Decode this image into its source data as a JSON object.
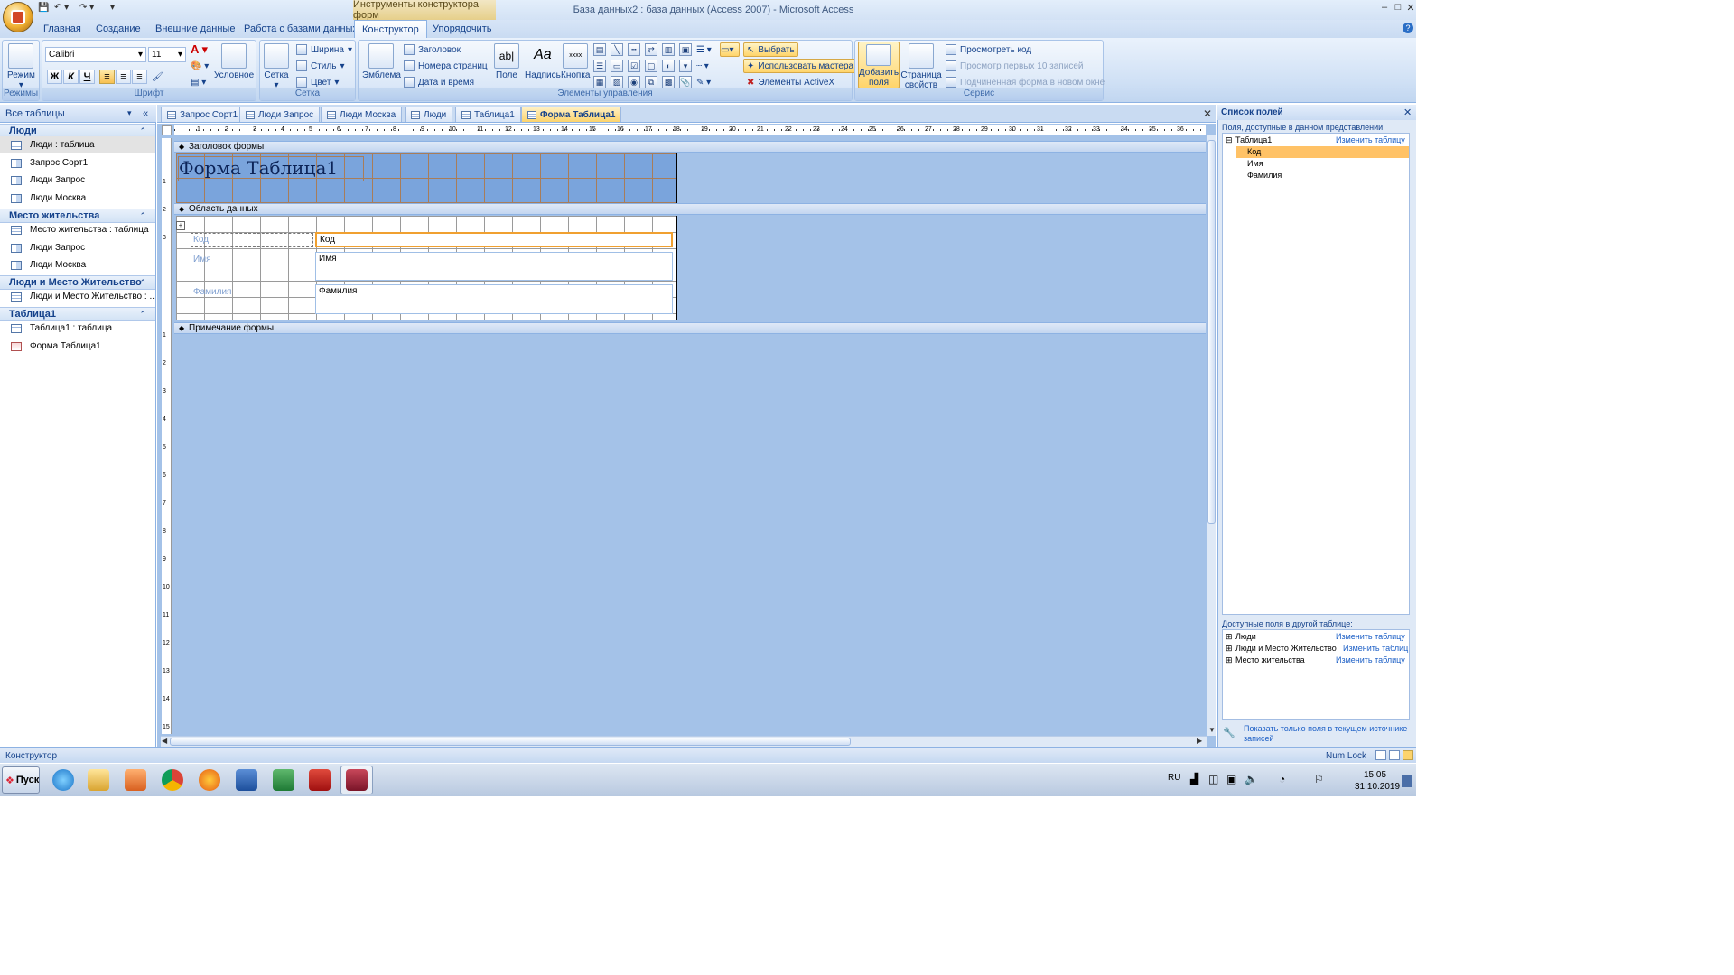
{
  "window": {
    "context_header": "Инструменты конструктора форм",
    "title": "База данных2 : база данных (Access 2007) - Microsoft Access",
    "controls": [
      "–",
      "□",
      "✕"
    ]
  },
  "ribbon_tabs": [
    "Главная",
    "Создание",
    "Внешние данные",
    "Работа с базами данных",
    "Конструктор",
    "Упорядочить"
  ],
  "active_tab": "Конструктор",
  "ribbon": {
    "views": {
      "label": "Режим",
      "group": "Режимы"
    },
    "font": {
      "group": "Шрифт",
      "font_name": "Calibri",
      "font_size": "11",
      "bold": "Ж",
      "italic": "К",
      "underline": "Ч",
      "conditional": "Условное"
    },
    "grid": {
      "group": "Сетка",
      "grid": "Сетка",
      "width": "Ширина",
      "style": "Стиль",
      "color": "Цвет"
    },
    "controls": {
      "group": "Элементы управления",
      "logo": "Эмблема",
      "title": "Заголовок",
      "page_numbers": "Номера страниц",
      "date_time": "Дата и время",
      "field": "Поле",
      "label": "Надпись",
      "button": "Кнопка",
      "select": "Выбрать",
      "use_wizard": "Использовать мастера",
      "activex": "Элементы ActiveX"
    },
    "tools": {
      "group": "Сервис",
      "add_fields": "Добавить поля",
      "property_sheet": "Страница свойств",
      "view_code": "Просмотреть код",
      "first10": "Просмотр первых 10 записей",
      "subform_new_window": "Подчиненная форма в новом окне"
    }
  },
  "nav": {
    "header": "Все таблицы",
    "groups": [
      {
        "name": "Люди",
        "items": [
          {
            "label": "Люди : таблица",
            "kind": "table",
            "selected": true
          },
          {
            "label": "Запрос Сорт1",
            "kind": "query"
          },
          {
            "label": "Люди Запрос",
            "kind": "query"
          },
          {
            "label": "Люди Москва",
            "kind": "query"
          }
        ]
      },
      {
        "name": "Место жительства",
        "items": [
          {
            "label": "Место жительства : таблица",
            "kind": "table"
          },
          {
            "label": "Люди Запрос",
            "kind": "query"
          },
          {
            "label": "Люди Москва",
            "kind": "query"
          }
        ]
      },
      {
        "name": "Люди и Место Жительство",
        "items": [
          {
            "label": "Люди и Место Жительство : ...",
            "kind": "table"
          }
        ]
      },
      {
        "name": "Таблица1",
        "items": [
          {
            "label": "Таблица1 : таблица",
            "kind": "table"
          },
          {
            "label": "Форма Таблица1",
            "kind": "form"
          }
        ]
      }
    ]
  },
  "doc_tabs": [
    "Запрос Сорт1",
    "Люди Запрос",
    "Люди Москва",
    "Люди",
    "Таблица1",
    "Форма Таблица1"
  ],
  "active_doc_tab": "Форма Таблица1",
  "design": {
    "sections": {
      "header": "Заголовок формы",
      "detail": "Область данных",
      "footer": "Примечание формы"
    },
    "form_title": "Форма Таблица1",
    "fields": [
      {
        "label": "Код",
        "value": "Код"
      },
      {
        "label": "Имя",
        "value": "Имя"
      },
      {
        "label": "Фамилия",
        "value": "Фамилия"
      }
    ],
    "ruler_marks": [
      "1",
      "2",
      "3",
      "4",
      "5",
      "6",
      "7",
      "8",
      "9",
      "10",
      "11",
      "12",
      "13",
      "14",
      "15",
      "16",
      "17",
      "18",
      "19",
      "20",
      "21",
      "22",
      "23",
      "24",
      "25",
      "26",
      "27",
      "28",
      "29",
      "30",
      "31",
      "32",
      "33",
      "34",
      "35",
      "36"
    ]
  },
  "field_list": {
    "title": "Список полей",
    "available_here": "Поля, доступные в данном представлении:",
    "table": "Таблица1",
    "edit_table": "Изменить таблицу",
    "fields": [
      "Код",
      "Имя",
      "Фамилия"
    ],
    "selected_field": "Код",
    "other_label": "Доступные поля в другой таблице:",
    "other_tables": [
      {
        "name": "Люди",
        "link": "Изменить таблицу"
      },
      {
        "name": "Люди и Место Жительство",
        "link": "Изменить таблиц"
      },
      {
        "name": "Место жительства",
        "link": "Изменить таблицу"
      }
    ],
    "show_only": "Показать только поля в текущем источнике записей"
  },
  "status": {
    "mode": "Конструктор",
    "numlock": "Num Lock"
  },
  "taskbar": {
    "start": "Пуск",
    "lang": "RU",
    "time": "15:05",
    "date": "31.10.2019"
  }
}
